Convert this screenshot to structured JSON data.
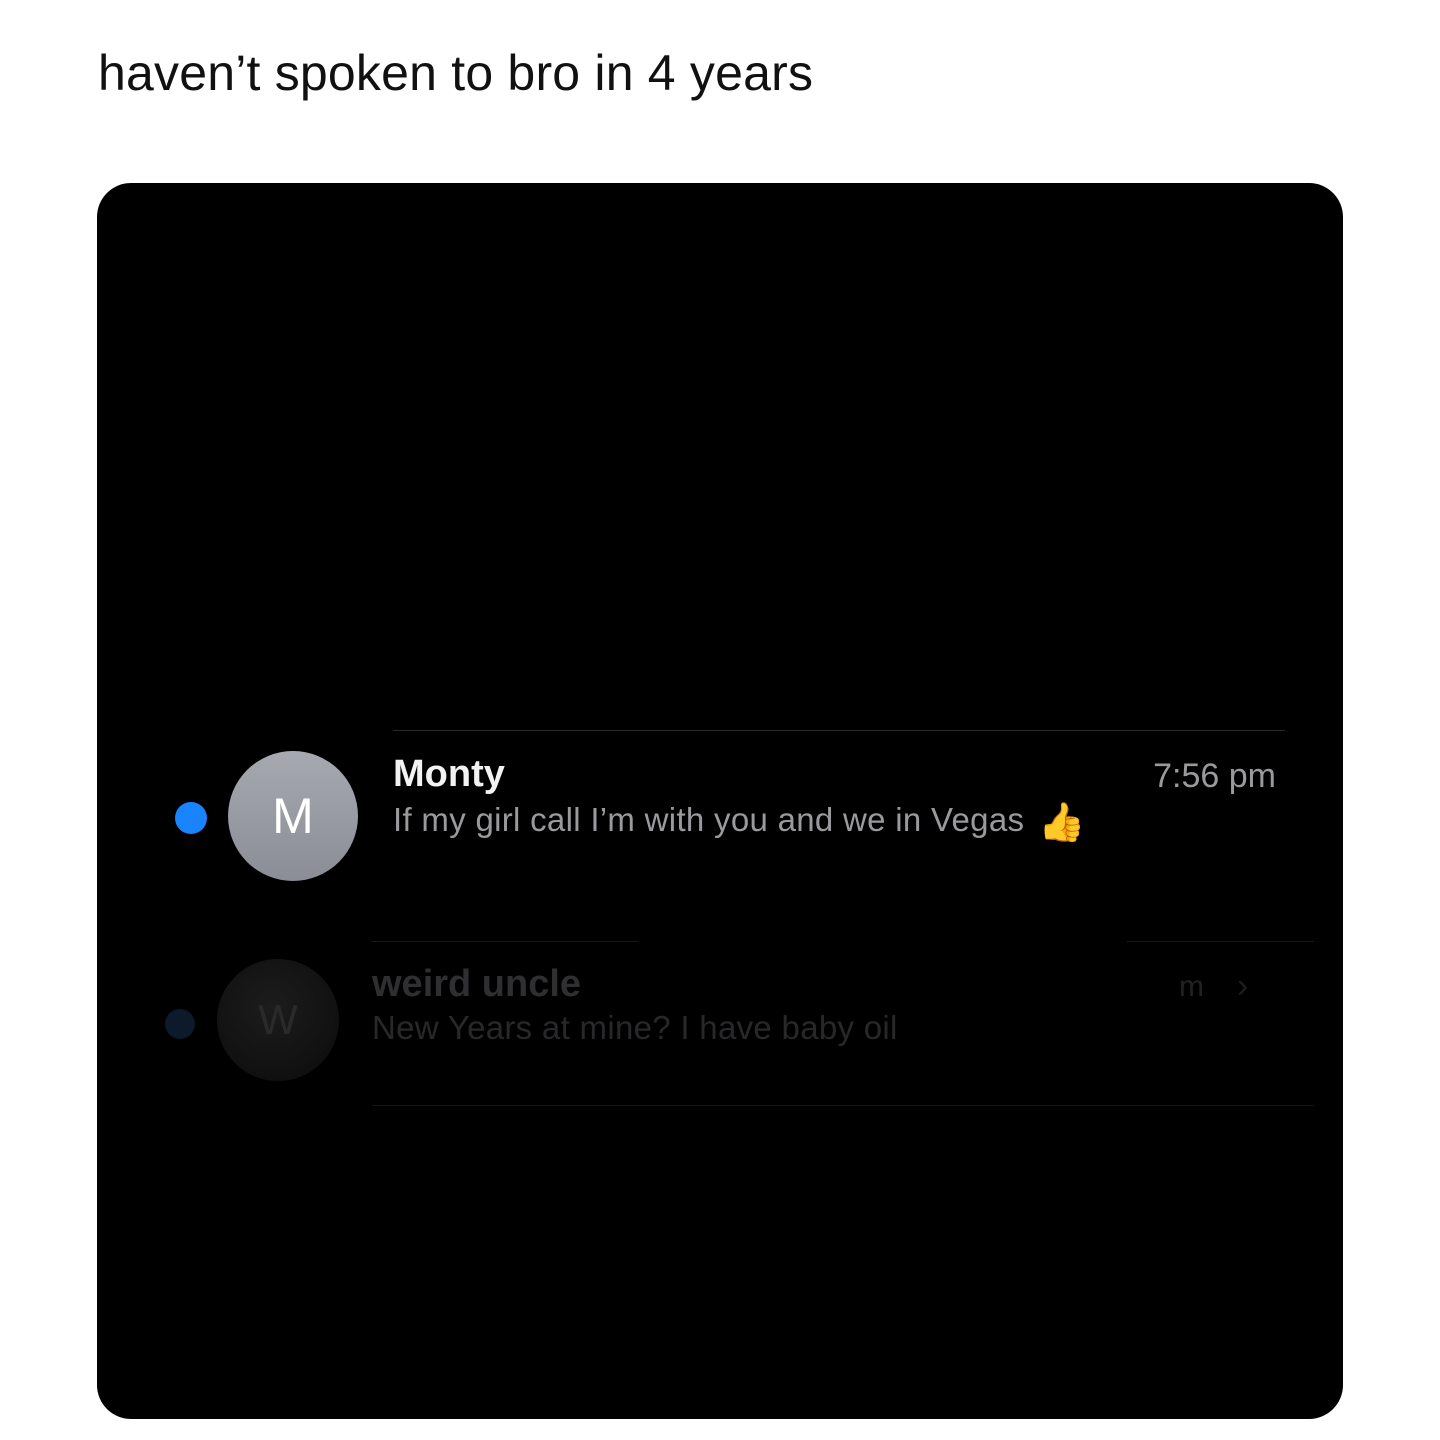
{
  "caption": "haven’t spoken to bro in 4 years",
  "conversations": [
    {
      "initial": "M",
      "name": "Monty",
      "time": "7:56 pm",
      "preview": "If my girl call I’m with you and we in Vegas",
      "preview_emoji": "👍",
      "unread": true
    },
    {
      "initial": "W",
      "name": "weird uncle",
      "time": "m",
      "preview": "New Years at mine? I have baby oil",
      "chevron": "›",
      "unread": true
    }
  ],
  "colors": {
    "unread_dot": "#1a84ff",
    "background": "#000000",
    "avatar": "#9a9ca4"
  },
  "icons": {
    "unread": "unread-dot-icon",
    "thumbs": "thumbs-up-icon",
    "chevron": "chevron-right-icon"
  }
}
